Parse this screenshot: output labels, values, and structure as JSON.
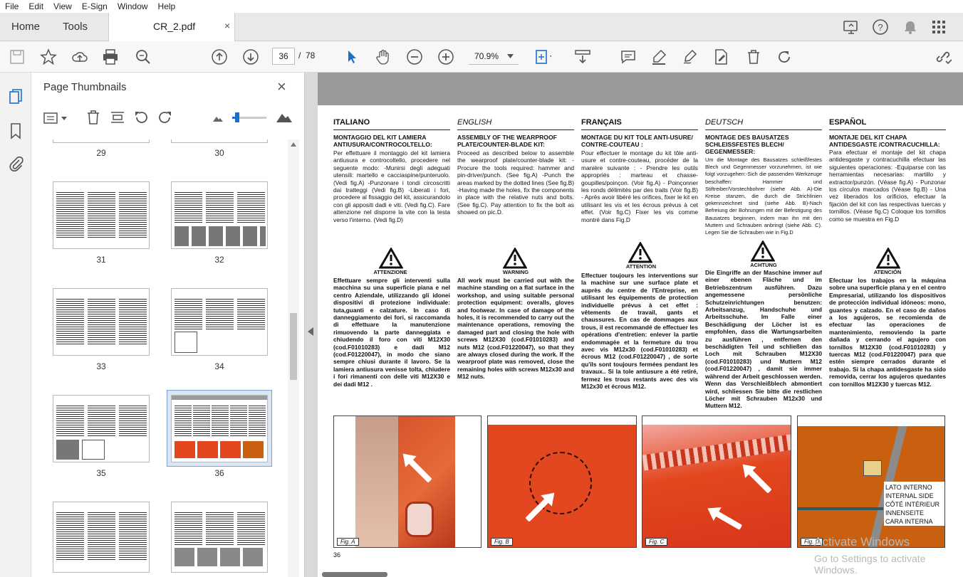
{
  "menu": [
    "File",
    "Edit",
    "View",
    "E-Sign",
    "Window",
    "Help"
  ],
  "tabs": {
    "home": "Home",
    "tools": "Tools",
    "doc": "CR_2.pdf",
    "close": "×"
  },
  "toolbar": {
    "page_current": "36",
    "page_sep": "/",
    "page_total": "78",
    "zoom": "70.9%"
  },
  "thumbs": {
    "title": "Page Thumbnails",
    "close": "×",
    "pages": [
      "29",
      "30",
      "31",
      "32",
      "33",
      "34",
      "35",
      "36"
    ]
  },
  "doc": {
    "page_number": "36",
    "columns": [
      {
        "head": "ITALIANO",
        "sub": "MONTAGGIO DEL KIT LAMIERA ANTIUSURA/CONTROCOLTELLO:",
        "body": "Per effettuare il montaggio del kit lamiera antiusura e controcoltello, procedere nel seguente modo: -Munirsi degli adeguati utensili: martello e cacciaspine/punteruolo. (Vedi fig.A) -Punzonare i tondi circoscritti dai tratteggi (Vedi fig.B) -Liberati i fori, procedere al fissaggio del kit, assicurandolo con gli appositi dadi e viti. (Vedi fig.C). Fare attenzione nel disporre la vite con la testa verso l'interno. (Vedi fig.D)",
        "warnlabel": "ATTENZIONE",
        "warn": "Effettuare sempre gli interventi sulla macchina su una superficie piana e nel centro Aziendale, utilizzando gli idonei dispositivi di protezione individuale: tuta,guanti e calzature. In caso di danneggiamento dei fori, si raccomanda di effettuare la manutenzione rimuovendo la parte danneggiata e chiudendo il foro con viti M12X30 (cod.F01010283) e dadi M12 (cod.F01220047), in modo che siano sempre chiusi durante il lavoro. Se la lamiera antiusura venisse tolta, chiudere i fori rimanenti con delle viti M12X30 e dei dadi M12 ."
      },
      {
        "head": "ENGLISH",
        "sub": "ASSEMBLY OF THE WEARPROOF PLATE/COUNTER-BLADE KIT:",
        "body": "Proceed as described below to assemble the wearproof plate/counter-blade kit: - Procure the tools required: hammer and pin-driver/punch. (See fig.A) -Punch the areas marked by the dotted lines (See fig.B) -Having made the holes, fix the components in place with the relative nuts and bolts. (See fig.C). Pay attention to fix the bolt as showed on pic.D.",
        "warnlabel": "WARNING",
        "warn": "All work must be carried out with the machine standing on a flat surface in the workshop, and using suitable personal protection equipment: overalls, gloves and footwear. In case of damage of the holes, it is recommended to carry out the maintenance operations, removing the damaged part and closing the hole with screws M12X30 (cod.F01010283) and nuts M12 (cod.F01220047), so that they are always closed during the work. If the wearproof plate was removed, close the remaining holes with screws M12x30 and M12 nuts."
      },
      {
        "head": "FRANÇAIS",
        "sub": "MONTAGE DU KIT TOLE ANTI-USURE/ CONTRE-COUTEAU :",
        "body": "Pour effectuer le montage du kit tôle anti-usure et contre-couteau, procéder de la manière suivante : - Prendre les outils appropriés : marteau et chasse-goupilles/poinçon. (Voir fig.A) - Poinçonner les ronds délimités par des traits (Voir fig.B) - Après avoir libéré les orifices, fixer le kit en utilisant les vis et les écrous prévus à cet effet. (Voir fig.C) Fixer les vis comme montré dans Fig.D",
        "warnlabel": "ATTENTION",
        "warn": "Effectuer toujours les interventions sur la machine sur une surface plate et auprès du centre de l'Entreprise, en utilisant les équipements de protection individuelle prévus à cet effet : vêtements de travail, gants et chaussures. En cas de dommages aux trous, il est recommandé de effectuer les opérations d'entretien: enlever la partie endommagée et la fermeture du trou avec vis M12x30 (cod.F01010283) et écrous M12 (cod.F01220047) , de sorte qu'ils sont toujours fermées pendant les travaux.. Si la tole antiusure a été retiré, fermez les trous restants avec des vis M12x30 et écrous M12."
      },
      {
        "head": "DEUTSCH",
        "sub": "MONTAGE DES BAUSATZES SCHLEISSFESTES BLECH/ GEGENMESSER:",
        "body": "Um die Montage des Bausatzes schleißfestes Blech und Gegenmesser vorzunehmen, ist wie folgt vorzugehen:-Sich die passenden Werkzeuge beschaffen: Hammer und Stiftreiber/Vorstechbohrer (siehe Abb. A)-Die Kreise stanzen, die durch die Strichlinien gekennzeichnet sind (siehe Abb. B)-Nach Befreiung der Bohrungen mit der Befestigung des Bausatzes beginnen, indem man ihn mit den Muttern und Schrauben anbringt (siehe Abb. C). Legen Sie die Schrauben wie in Fig.D",
        "warnlabel": "ACHTUNG",
        "warn": "Die Eingriffe an der Maschine immer auf einer ebenen Fläche und im Betriebszentrum ausführen. Dazu angemessene persönliche Schutzeinrichtungen benutzen: Arbeitsanzug, Handschuhe und Arbeitsschuhe. Im Falle einer Beschädigung der Löcher ist es empfohlen, dass die Wartungsarbeiten zu ausführen , entfernen den beschädigten Teil und schließen das Loch mit Schrauben M12X30 (cod.F01010283) und Muttern M12 (cod.F01220047) , damit sie immer während der Arbeit geschlossen werden. Wenn das Verschleißblech abmontiert wird, schliessen Sie bitte die restlichen Löcher mit Schrauben M12x30 und Muttern M12."
      },
      {
        "head": "ESPAÑOL",
        "sub": "MONTAJE DEL KIT CHAPA ANTIDESGASTE /CONTRACUCHILLA:",
        "body": "Para efectuar el montaje del kit chapa antidesgaste y contracuchilla efectuar las siguientes operaciones: -Equiparse con las herramientas necesarias: martillo y extractor/punzón. (Véase fig.A) - Punzonar los círculos marcados (Véase fig.B) - Una vez liberados los orificios, efectuar la fijación del kit con las respectivas tuercas y tornillos. (Véase fig.C) Coloque los tornillos como se muestra en Fig.D",
        "warnlabel": "ATENCIÓN",
        "warn": "Efectuar los trabajos en la máquina sobre una superficie plana y en el centro Empresarial, utilizando los dispositivos de protección individual idóneos: mono, guantes y calzado. En el caso de daños a los agujeros, se recomienda de efectuar las operaciones de mantenimiento, removiendo la parte dañada y cerrando el agujero con tornillos M12X30 (cod.F01010283) y tuercas M12 (cod.F01220047) para que estén siempre cerrados durante el trabajo. Si la chapa antidesgaste ha sido removida, cerrar los agujeros quedantes con tornillos M12X30 y tuercas M12."
      }
    ],
    "figs": [
      "Fig. A",
      "Fig. B",
      "Fig. C",
      "Fig. D"
    ],
    "figd_labels": [
      "LATO INTERNO",
      "INTERNAL SIDE",
      "CÔTÉ INTÉRIEUR",
      "INNENSEITE",
      "CARA INTERNA"
    ]
  },
  "watermark": {
    "line1": "Activate Windows",
    "line2": "Go to Settings to activate Windows."
  },
  "colors": {
    "accent": "#1a6fc9",
    "tabbar": "#e9e9e9",
    "header_band": "#9a9a9a",
    "photo_orange": "#e2471f"
  }
}
